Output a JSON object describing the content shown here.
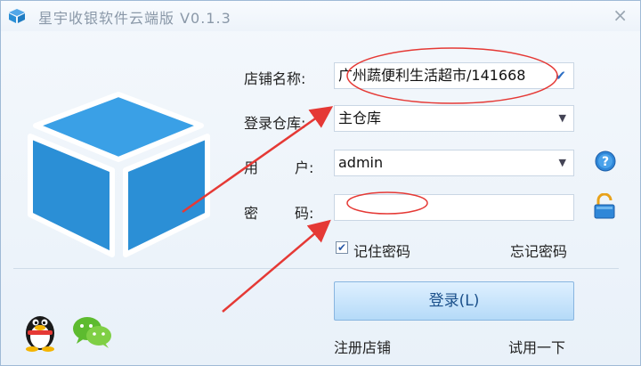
{
  "window": {
    "title": "星宇收银软件云端版 V0.1.3",
    "close_glyph": "×"
  },
  "form": {
    "store_label": "店铺名称:",
    "store_value": "广州蔬便利生活超市/141668",
    "warehouse_label": "登录仓库:",
    "warehouse_value": "主仓库",
    "user_label_1": "用",
    "user_label_2": "户:",
    "user_value": "admin",
    "password_label_1": "密",
    "password_label_2": "码:",
    "password_value": "",
    "remember_checked": true,
    "remember_label": "记住密码",
    "forgot_label": "忘记密码"
  },
  "actions": {
    "login_label": "登录(L)",
    "register_label": "注册店铺",
    "trial_label": "试用一下"
  },
  "icons": {
    "app": "cube-icon",
    "help": "question-icon",
    "lock": "lock-icon",
    "qq": "qq-penguin-icon",
    "wechat": "wechat-icon"
  },
  "colors": {
    "brand_blue": "#2b8fd6",
    "annotation_red": "#e53935"
  }
}
